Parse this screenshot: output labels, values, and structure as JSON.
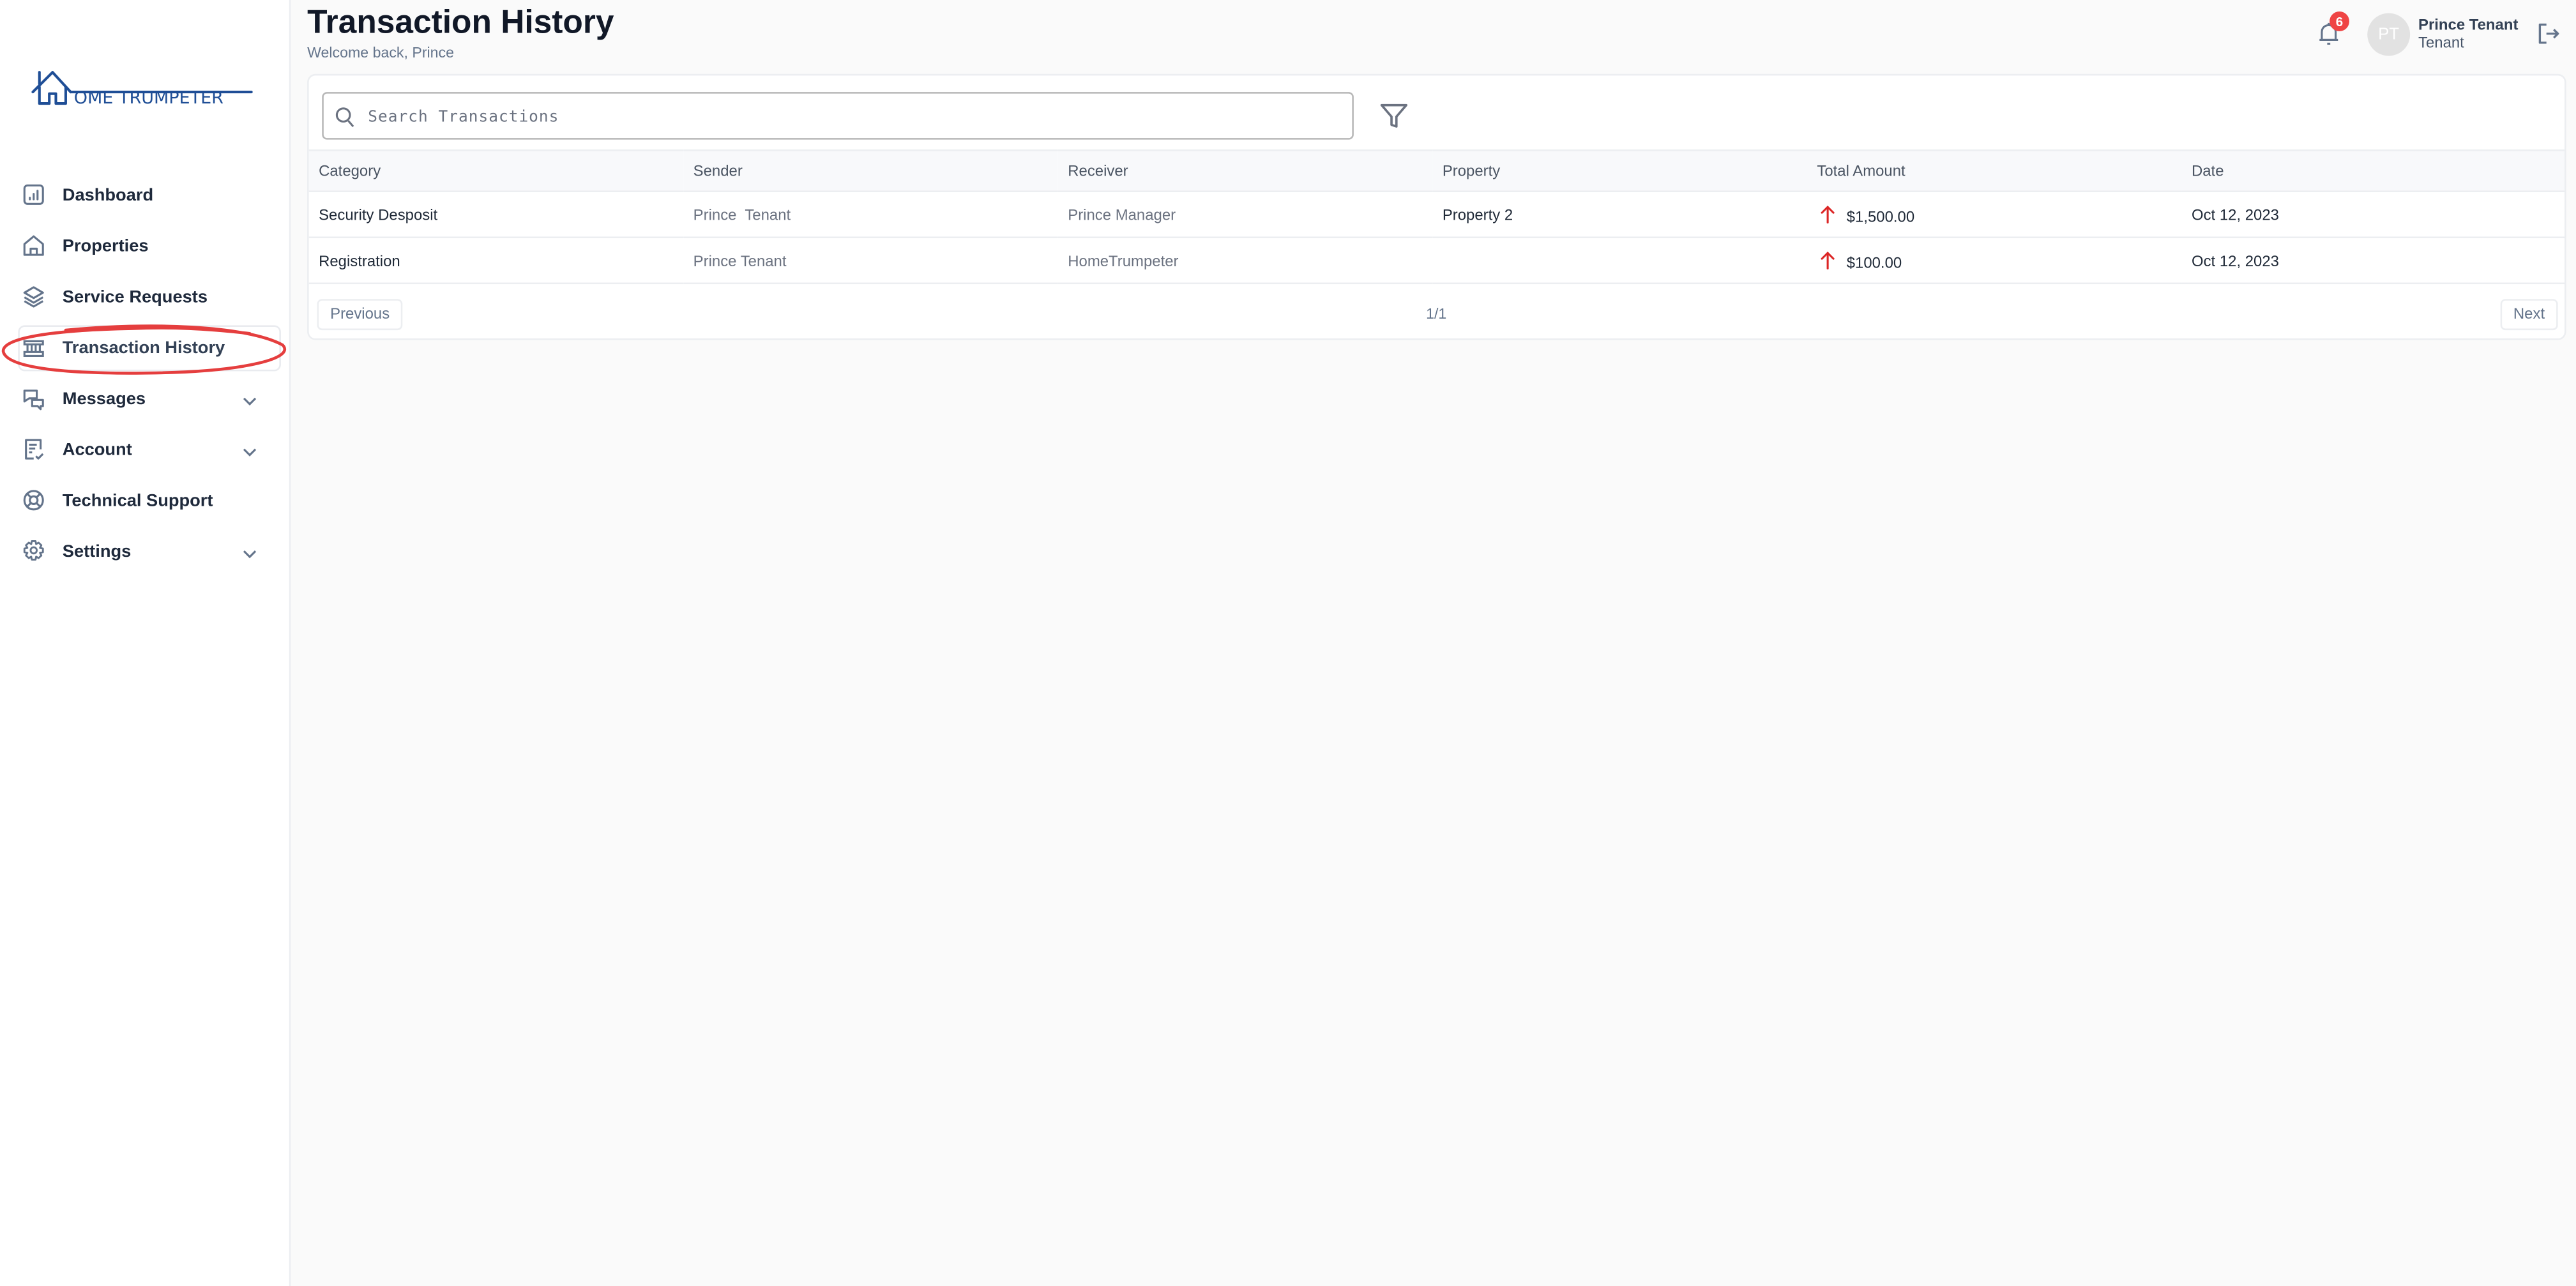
{
  "app": {
    "brand": "HOME TRUMPETER",
    "brand_color": "#1f4e96"
  },
  "sidebar": {
    "items": [
      {
        "label": "Dashboard",
        "icon": "chart-bar-icon",
        "expandable": false,
        "active": false
      },
      {
        "label": "Properties",
        "icon": "home-icon",
        "expandable": false,
        "active": false
      },
      {
        "label": "Service Requests",
        "icon": "layers-icon",
        "expandable": false,
        "active": false
      },
      {
        "label": "Transaction History",
        "icon": "bank-icon",
        "expandable": false,
        "active": true
      },
      {
        "label": "Messages",
        "icon": "chat-icon",
        "expandable": true,
        "active": false
      },
      {
        "label": "Account",
        "icon": "document-check-icon",
        "expandable": true,
        "active": false
      },
      {
        "label": "Technical Support",
        "icon": "lifebuoy-icon",
        "expandable": false,
        "active": false
      },
      {
        "label": "Settings",
        "icon": "gear-icon",
        "expandable": true,
        "active": false
      }
    ],
    "annotation_color": "#e53e3e"
  },
  "header": {
    "title": "Transaction History",
    "subtitle": "Welcome back, Prince",
    "notification_count": "6",
    "avatar_initials": "PT",
    "user_name": "Prince Tenant",
    "user_role": "Tenant"
  },
  "search": {
    "placeholder": "Search Transactions",
    "value": ""
  },
  "table": {
    "columns": [
      "Category",
      "Sender",
      "Receiver",
      "Property",
      "Total Amount",
      "Date"
    ],
    "rows": [
      {
        "category": "Security Desposit",
        "sender": "Prince  Tenant",
        "receiver": "Prince Manager",
        "property": "Property 2",
        "amount": "$1,500.00",
        "direction": "up",
        "date": "Oct 12, 2023"
      },
      {
        "category": "Registration",
        "sender": "Prince Tenant",
        "receiver": "HomeTrumpeter",
        "property": "",
        "amount": "$100.00",
        "direction": "up",
        "date": "Oct 12, 2023"
      }
    ]
  },
  "pagination": {
    "previous_label": "Previous",
    "page_indicator": "1/1",
    "next_label": "Next"
  },
  "colors": {
    "badge": "#ef4444",
    "amount_arrow": "#dc2626"
  }
}
